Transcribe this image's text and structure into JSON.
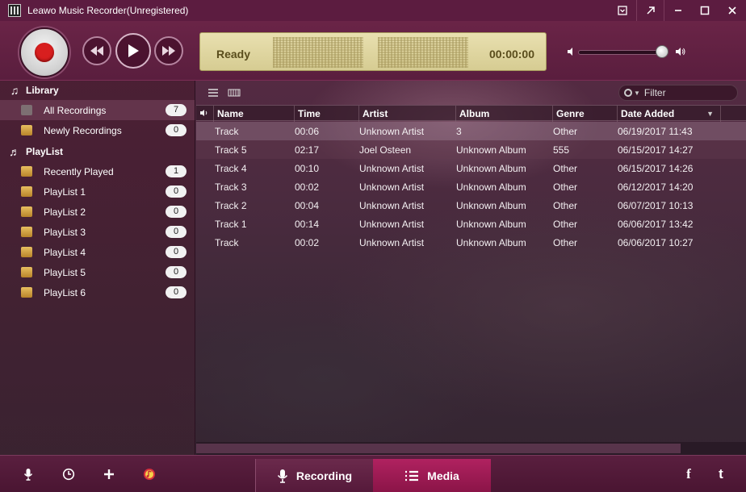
{
  "window": {
    "title": "Leawo Music Recorder(Unregistered)",
    "controls": {
      "menu": "⊡",
      "mini": "↗",
      "minimize": "—",
      "maximize": "☐",
      "close": "✕"
    }
  },
  "player": {
    "status": "Ready",
    "time": "00:00:00",
    "volume_fraction": 0.93
  },
  "sidebar": {
    "library_title": "Library",
    "library_items": [
      {
        "label": "All Recordings",
        "count": "7"
      },
      {
        "label": "Newly Recordings",
        "count": "0"
      }
    ],
    "playlist_title": "PlayList",
    "playlist_items": [
      {
        "label": "Recently Played",
        "count": "1"
      },
      {
        "label": "PlayList 1",
        "count": "0"
      },
      {
        "label": "PlayList 2",
        "count": "0"
      },
      {
        "label": "PlayList 3",
        "count": "0"
      },
      {
        "label": "PlayList 4",
        "count": "0"
      },
      {
        "label": "PlayList 5",
        "count": "0"
      },
      {
        "label": "PlayList 6",
        "count": "0"
      }
    ]
  },
  "toolbar": {
    "filter_placeholder": "Filter"
  },
  "table": {
    "columns": [
      "Name",
      "Time",
      "Artist",
      "Album",
      "Genre",
      "Date Added"
    ],
    "rows": [
      [
        "Track",
        "00:06",
        "Unknown Artist",
        "3",
        "Other",
        "06/19/2017 11:43"
      ],
      [
        "Track 5",
        "02:17",
        "Joel Osteen",
        "Unknown Album",
        "555",
        "06/15/2017 14:27"
      ],
      [
        "Track 4",
        "00:10",
        "Unknown Artist",
        "Unknown Album",
        "Other",
        "06/15/2017 14:26"
      ],
      [
        "Track 3",
        "00:02",
        "Unknown Artist",
        "Unknown Album",
        "Other",
        "06/12/2017 14:20"
      ],
      [
        "Track 2",
        "00:04",
        "Unknown Artist",
        "Unknown Album",
        "Other",
        "06/07/2017 10:13"
      ],
      [
        "Track 1",
        "00:14",
        "Unknown Artist",
        "Unknown Album",
        "Other",
        "06/06/2017 13:42"
      ],
      [
        "Track",
        "00:02",
        "Unknown Artist",
        "Unknown Album",
        "Other",
        "06/06/2017 10:27"
      ]
    ]
  },
  "bottom": {
    "tabs": {
      "recording": "Recording",
      "media": "Media"
    },
    "icons": [
      "microphone-icon",
      "clock-icon",
      "plus-icon",
      "itunes-icon"
    ],
    "social": {
      "facebook": "f",
      "twitter": "t"
    }
  },
  "colors": {
    "accent": "#b02260",
    "record": "#d81f1f",
    "lcd": "#e2d8a2"
  }
}
